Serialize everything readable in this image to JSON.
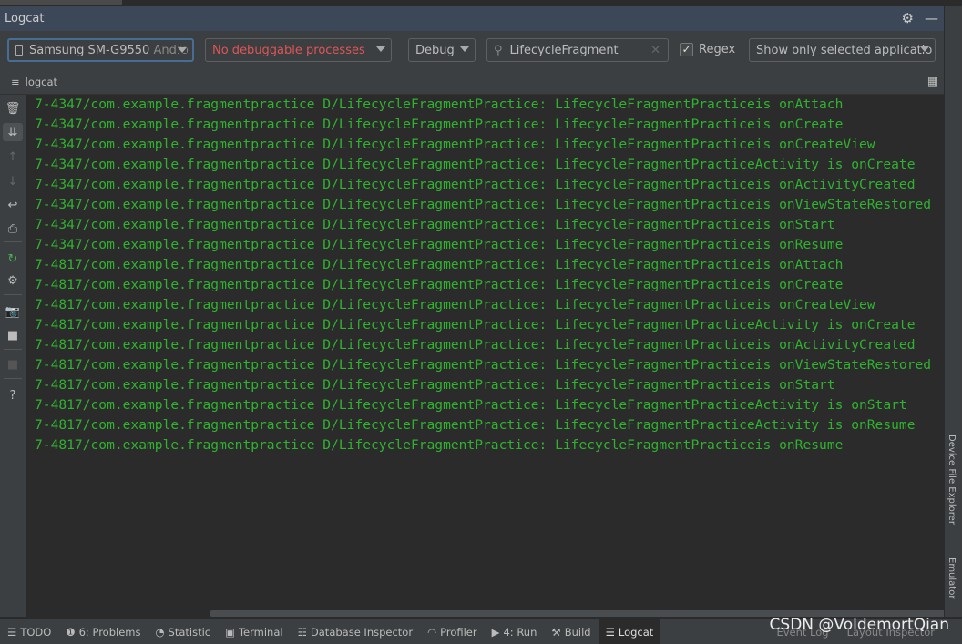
{
  "panel": {
    "title": "Logcat"
  },
  "toolbar": {
    "device": {
      "name": "Samsung SM-G9550",
      "suffix": "Andro"
    },
    "process": "No debuggable processes",
    "level": "Debug",
    "search": {
      "value": "LifecycleFragment"
    },
    "regex": {
      "label": "Regex",
      "checked": true
    },
    "filter": "Show only selected applicatio"
  },
  "subbar": {
    "tab": "logcat"
  },
  "log_lines": [
    "7-4347/com.example.fragmentpractice D/LifecycleFragmentPractice: LifecycleFragmentPracticeis onAttach",
    "7-4347/com.example.fragmentpractice D/LifecycleFragmentPractice: LifecycleFragmentPracticeis onCreate",
    "7-4347/com.example.fragmentpractice D/LifecycleFragmentPractice: LifecycleFragmentPracticeis onCreateView",
    "7-4347/com.example.fragmentpractice D/LifecycleFragmentPractice: LifecycleFragmentPracticeActivity is onCreate",
    "7-4347/com.example.fragmentpractice D/LifecycleFragmentPractice: LifecycleFragmentPracticeis onActivityCreated",
    "7-4347/com.example.fragmentpractice D/LifecycleFragmentPractice: LifecycleFragmentPracticeis onViewStateRestored",
    "7-4347/com.example.fragmentpractice D/LifecycleFragmentPractice: LifecycleFragmentPracticeis onStart",
    "7-4347/com.example.fragmentpractice D/LifecycleFragmentPractice: LifecycleFragmentPracticeis onResume",
    "7-4817/com.example.fragmentpractice D/LifecycleFragmentPractice: LifecycleFragmentPracticeis onAttach",
    "7-4817/com.example.fragmentpractice D/LifecycleFragmentPractice: LifecycleFragmentPracticeis onCreate",
    "7-4817/com.example.fragmentpractice D/LifecycleFragmentPractice: LifecycleFragmentPracticeis onCreateView",
    "7-4817/com.example.fragmentpractice D/LifecycleFragmentPractice: LifecycleFragmentPracticeActivity is onCreate",
    "7-4817/com.example.fragmentpractice D/LifecycleFragmentPractice: LifecycleFragmentPracticeis onActivityCreated",
    "7-4817/com.example.fragmentpractice D/LifecycleFragmentPractice: LifecycleFragmentPracticeis onViewStateRestored",
    "7-4817/com.example.fragmentpractice D/LifecycleFragmentPractice: LifecycleFragmentPracticeis onStart",
    "7-4817/com.example.fragmentpractice D/LifecycleFragmentPractice: LifecycleFragmentPracticeActivity is onStart",
    "7-4817/com.example.fragmentpractice D/LifecycleFragmentPractice: LifecycleFragmentPracticeActivity is onResume",
    "7-4817/com.example.fragmentpractice D/LifecycleFragmentPractice: LifecycleFragmentPracticeis onResume"
  ],
  "right_tools": [
    "Device File Explorer",
    "Emulator"
  ],
  "bottom_tabs": [
    {
      "icon": "list-icon",
      "glyph": "☰",
      "label": "TODO"
    },
    {
      "icon": "problems-icon",
      "glyph": "❶",
      "label": "6: Problems"
    },
    {
      "icon": "statistic-icon",
      "glyph": "◔",
      "label": "Statistic"
    },
    {
      "icon": "terminal-icon",
      "glyph": "▣",
      "label": "Terminal"
    },
    {
      "icon": "database-icon",
      "glyph": "☷",
      "label": "Database Inspector"
    },
    {
      "icon": "profiler-icon",
      "glyph": "◠",
      "label": "Profiler"
    },
    {
      "icon": "run-icon",
      "glyph": "▶",
      "label": "4: Run"
    },
    {
      "icon": "build-icon",
      "glyph": "⚒",
      "label": "Build"
    },
    {
      "icon": "logcat-icon",
      "glyph": "☰",
      "label": "Logcat"
    }
  ],
  "bottom_right": {
    "event_log": "Event Log",
    "layout_inspector": "Layout Inspector"
  },
  "watermark": "CSDN @VoldemortQian",
  "colors": {
    "log_text": "#2fb32f",
    "process_error": "#e05555",
    "title_bar": "#3c4858"
  }
}
